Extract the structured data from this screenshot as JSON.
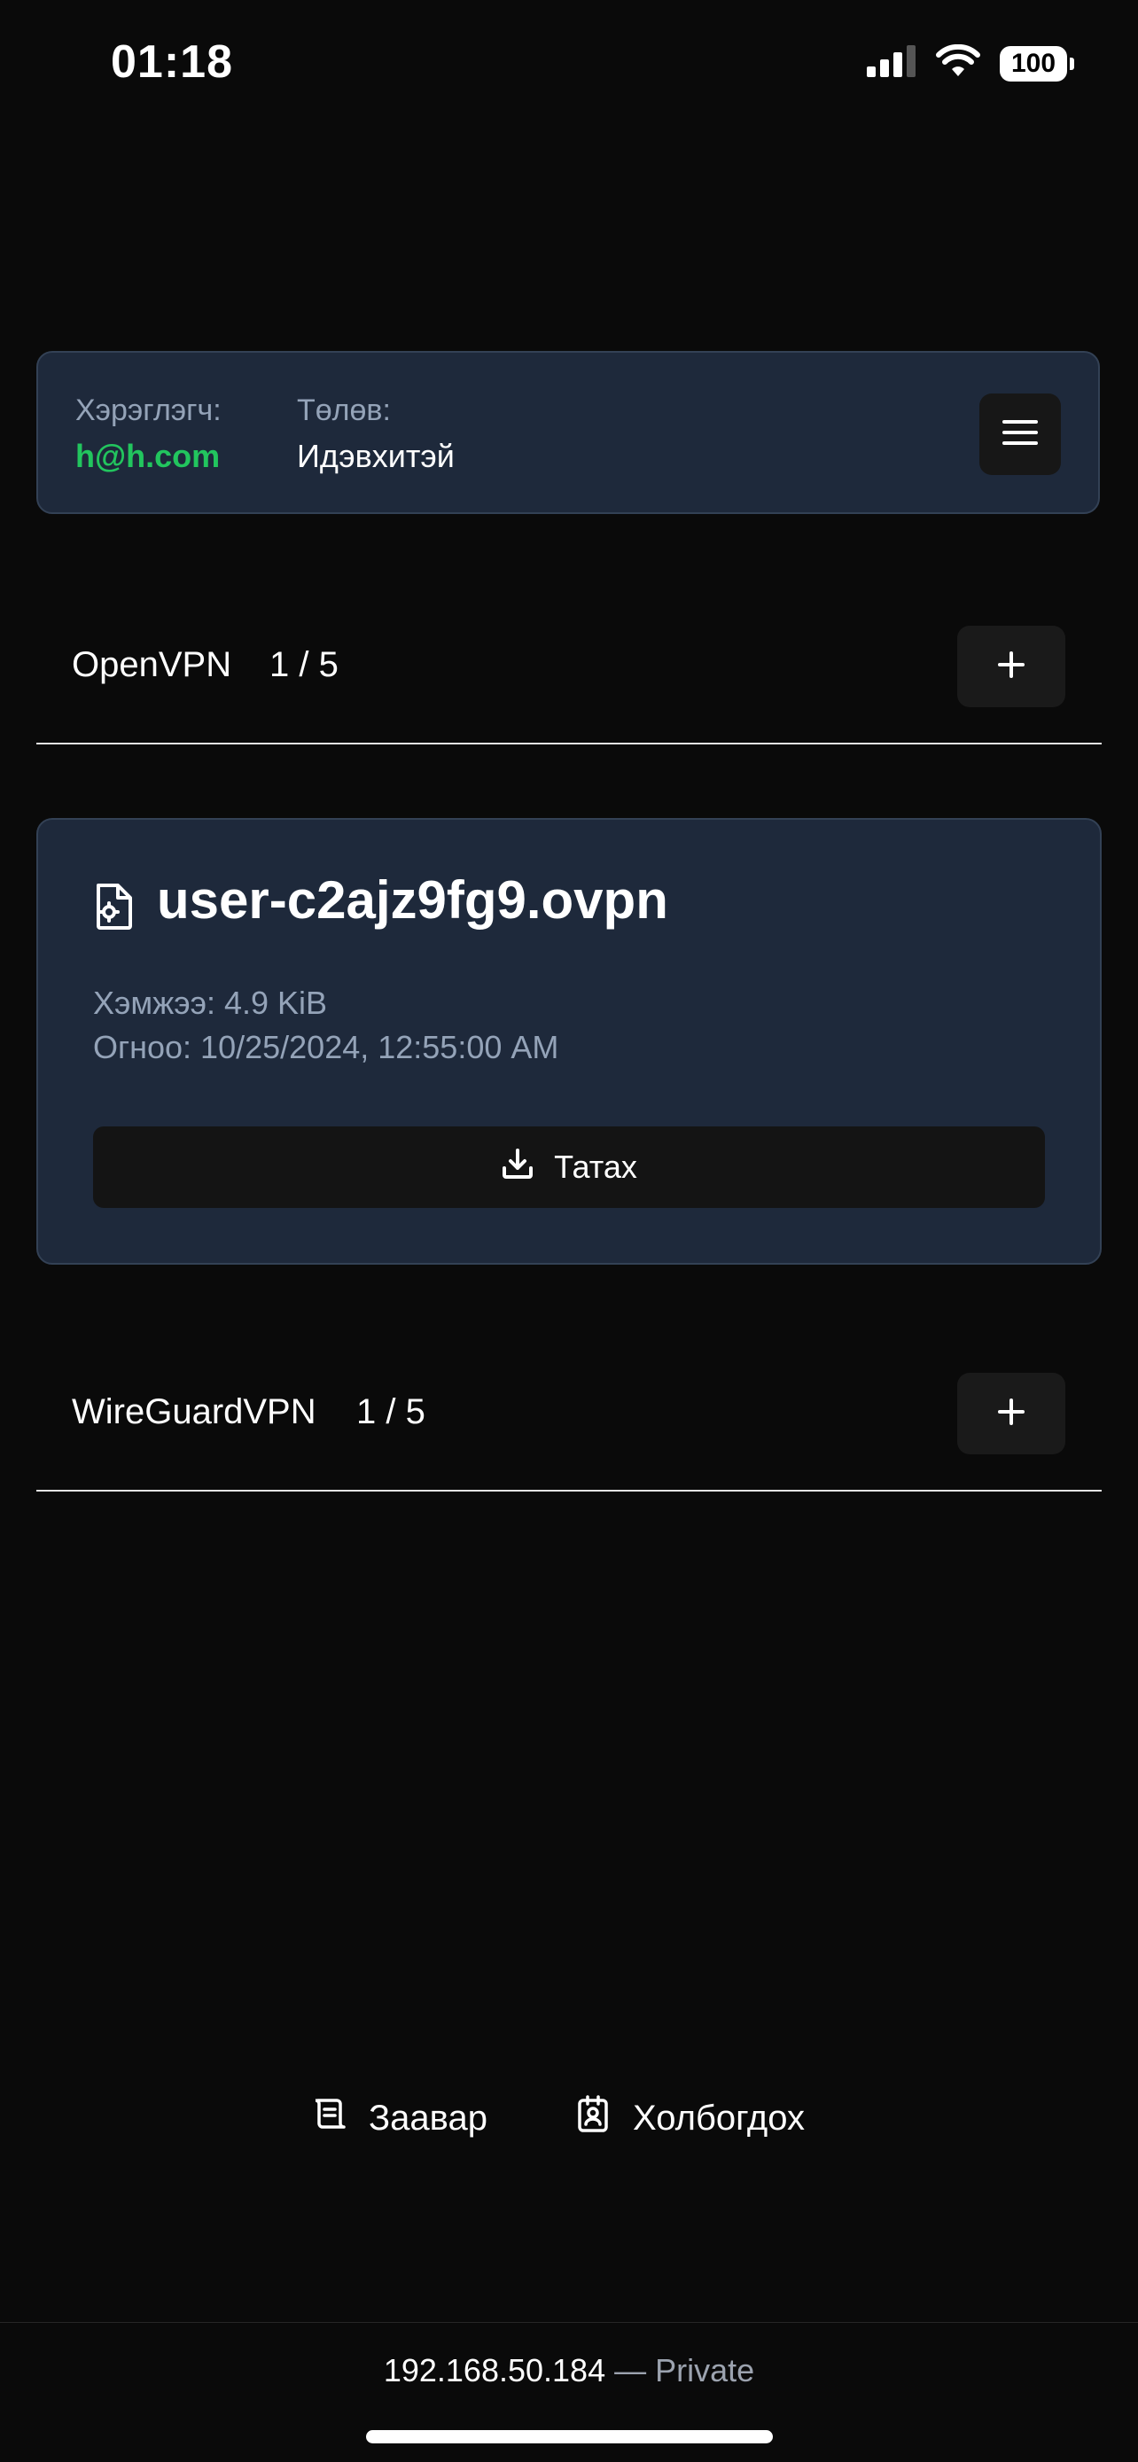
{
  "status_bar": {
    "time": "01:18",
    "battery": "100",
    "icons": [
      "signal-icon",
      "wifi-icon",
      "battery-icon"
    ]
  },
  "user_panel": {
    "user_label": "Хэрэглэгч:",
    "user_email": "h@h.com",
    "status_label": "Төлөв:",
    "status_value": "Идэвхитэй",
    "menu_icon": "hamburger-menu-icon"
  },
  "openvpn": {
    "title": "OpenVPN",
    "count": "1 / 5",
    "add_icon": "plus-icon"
  },
  "file_card": {
    "icon": "file-settings-icon",
    "file_name": "user-c2ajz9fg9.ovpn",
    "size": "Хэмжээ: 4.9 KiB",
    "date": "Огноо: 10/25/2024, 12:55:00 AM",
    "download_label": "Татах",
    "download_icon": "download-icon"
  },
  "wireguard": {
    "title": "WireGuardVPN",
    "count": "1 / 5",
    "add_icon": "plus-icon"
  },
  "footer_links": {
    "guide_label": "Заавар",
    "guide_icon": "scroll-icon",
    "contact_label": "Холбогдох",
    "contact_icon": "contact-icon"
  },
  "bottom_bar": {
    "ip": "192.168.50.184",
    "suffix": "— Private"
  },
  "colors": {
    "background": "#0a0a0a",
    "panel": "#1e293b",
    "panel_border": "#334155",
    "accent_green": "#22c55e",
    "muted_text": "#94a3b8"
  }
}
